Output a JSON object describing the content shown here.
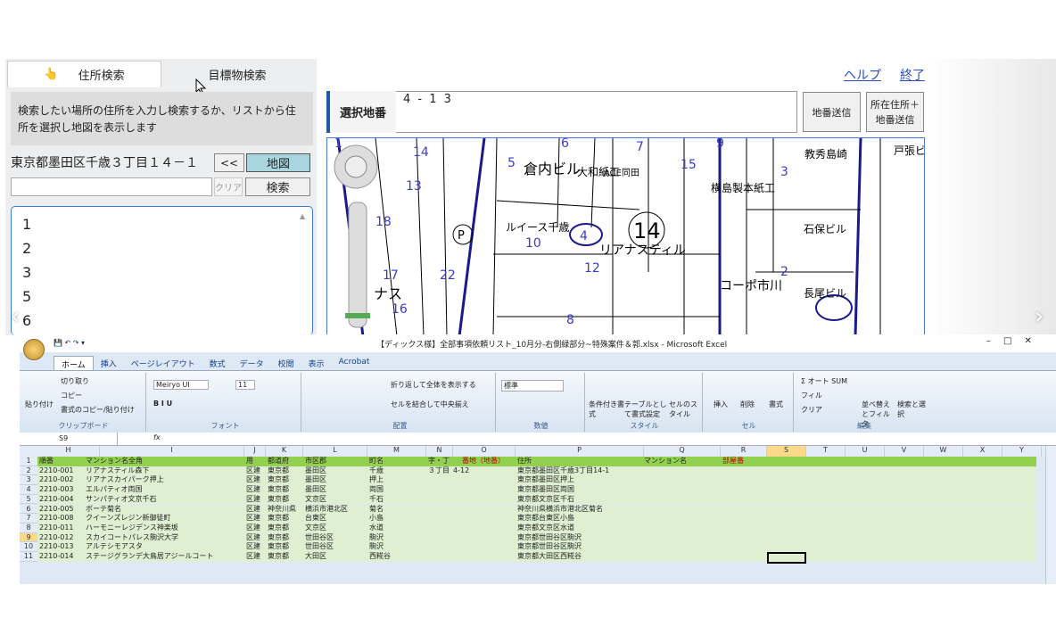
{
  "left_panel": {
    "tabs": [
      "住所検索",
      "目標物検索"
    ],
    "instruction": "検索したい場所の住所を入力し検索するか、リストから住所を選択し地図を表示します",
    "address": "東京都墨田区千歳３丁目１４－１",
    "prev_label": "<<",
    "map_label": "地図",
    "clear_label": "クリア",
    "search_label": "検索",
    "list_items": [
      "1",
      "2",
      "3",
      "5",
      "6"
    ]
  },
  "header_links": {
    "help": "ヘルプ",
    "end": "終了"
  },
  "lot_bar": {
    "label": "選択地番",
    "value": "4 - 1 3",
    "send_lot": "地番送信",
    "send_address": "所在住所＋地番送信"
  },
  "map": {
    "labels": [
      "倉内ビル",
      "大和紙工",
      "ACE同田",
      "横島製本紙工",
      "教秀島崎",
      "戸張ビル",
      "ルイース千歳",
      "リアナスティル",
      "石保ビル",
      "コーポ市川",
      "長尾ビル",
      "ナス"
    ],
    "numbers": [
      "14",
      "5",
      "6",
      "7",
      "9",
      "15",
      "3",
      "13",
      "18",
      "4",
      "12",
      "17",
      "22",
      "16",
      "8",
      "2",
      "10",
      "1"
    ]
  },
  "excel": {
    "title": "【ディックス様】全部事項依頼リスト_10月分-右側緑部分~特殊案件＆郭.xlsx - Microsoft Excel",
    "ribbon_tabs": [
      "ホーム",
      "挿入",
      "ページレイアウト",
      "数式",
      "データ",
      "校閲",
      "表示",
      "Acrobat"
    ],
    "groups": [
      "クリップボード",
      "フォント",
      "配置",
      "数値",
      "スタイル",
      "セル",
      "編集"
    ],
    "clipboard": {
      "paste": "貼り付け",
      "cut": "切り取り",
      "copy": "コピー",
      "format_copy": "書式のコピー/貼り付け"
    },
    "font": {
      "name": "Meiryo UI",
      "size": "11"
    },
    "alignment": {
      "wrap": "折り返して全体を表示する",
      "merge": "セルを結合して中央揃え"
    },
    "number_format": "標準",
    "styles": {
      "cond": "条件付き書式",
      "table": "テーブルとして書式設定",
      "cell": "セルのスタイル"
    },
    "cells_grp": {
      "insert": "挿入",
      "delete": "削除",
      "format": "書式"
    },
    "editing": {
      "autosum": "Σ オート SUM",
      "fill": "フィル",
      "clear": "クリア",
      "sort": "並べ替えとフィルタ",
      "find": "検索と選択"
    },
    "name_box": "S9",
    "fx": "fx",
    "columns": [
      "H",
      "I",
      "J",
      "K",
      "L",
      "M",
      "N",
      "O",
      "P",
      "Q",
      "R",
      "S",
      "T",
      "U",
      "V",
      "W",
      "X",
      "Y"
    ],
    "header_row": [
      "順番",
      "マンション名全角",
      "用",
      "都道府",
      "市区郡",
      "町名",
      "字・丁",
      "番地（地番）",
      "住所",
      "マンション名",
      "部屋番"
    ],
    "rows": [
      [
        "2",
        "2210-001",
        "リアナスティル森下",
        "区建",
        "東京都",
        "墨田区",
        "千歳",
        "３丁目",
        "4-12",
        "東京都墨田区千歳3丁目14-1"
      ],
      [
        "3",
        "2210-002",
        "リアナスカイパーク押上",
        "区建",
        "東京都",
        "墨田区",
        "押上",
        "",
        "",
        "東京都墨田区押上"
      ],
      [
        "4",
        "2210-003",
        "エルパティオ両国",
        "区建",
        "東京都",
        "墨田区",
        "両国",
        "",
        "",
        "東京都墨田区両国"
      ],
      [
        "5",
        "2210-004",
        "サンパティオ文京千石",
        "区建",
        "東京都",
        "文京区",
        "千石",
        "",
        "",
        "東京都文京区千石"
      ],
      [
        "6",
        "2210-005",
        "ボーテ菊名",
        "区建",
        "神奈川県",
        "横浜市港北区",
        "菊名",
        "",
        "",
        "神奈川県横浜市港北区菊名"
      ],
      [
        "7",
        "2210-008",
        "クイーンズレジン新御徒町",
        "区建",
        "東京都",
        "台東区",
        "小島",
        "",
        "",
        "東京都台東区小島"
      ],
      [
        "8",
        "2210-011",
        "ハーモニーレジデンス神楽坂",
        "区建",
        "東京都",
        "文京区",
        "水道",
        "",
        "",
        "東京都文京区水道"
      ],
      [
        "9",
        "2210-012",
        "スカイコートパレス駒沢大学",
        "区建",
        "東京都",
        "世田谷区",
        "駒沢",
        "",
        "",
        "東京都世田谷区駒沢"
      ],
      [
        "10",
        "2210-013",
        "アルテシモアスタ",
        "区建",
        "東京都",
        "世田谷区",
        "駒沢",
        "",
        "",
        "東京都世田谷区駒沢"
      ],
      [
        "11",
        "2210-014",
        "ステージグランデ大鳥居アジールコート",
        "区建",
        "東京都",
        "大田区",
        "西糀谷",
        "",
        "",
        "東京都大田区西糀谷"
      ]
    ]
  }
}
